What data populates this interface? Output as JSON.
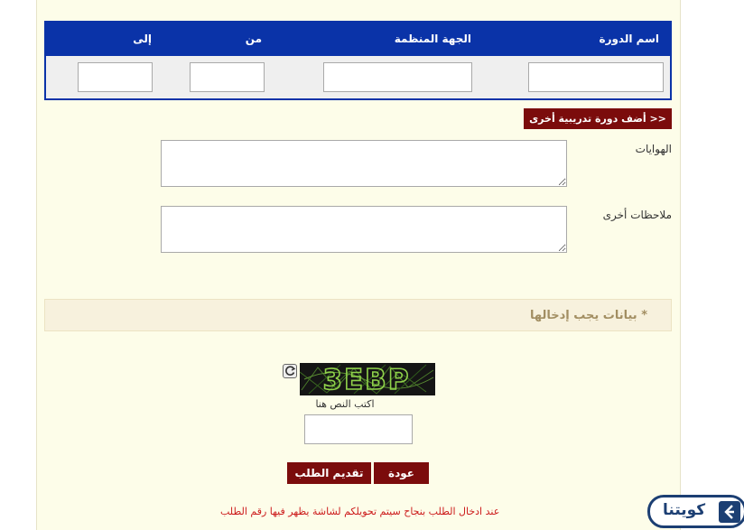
{
  "courses_table": {
    "headers": {
      "course_name": "اسم الدورة",
      "organizer": "الجهة المنظمة",
      "from": "من",
      "to": "إلى"
    },
    "row": {
      "course_name": "",
      "organizer": "",
      "from": "",
      "to": ""
    }
  },
  "add_course_button": "<< أضف دورة تدريبية أخرى",
  "hobbies": {
    "label": "الهوايات",
    "value": ""
  },
  "other_notes": {
    "label": "ملاحظات أخرى",
    "value": ""
  },
  "required_note": "* بيانات يجب إدخالها",
  "captcha": {
    "image_text": "3EBP",
    "hint": "اكتب النص هنا",
    "value": ""
  },
  "buttons": {
    "back": "عودة",
    "submit": "تقديم الطلب"
  },
  "notice": "عند ادخال الطلب بنجاح سيتم تحويلكم لشاشة يظهر فيها رقم الطلب",
  "logo": {
    "text": "كويتنا",
    "icon": "k-logo-icon"
  },
  "colors": {
    "table_header": "#0a33a8",
    "button_bg": "#7b0c0c",
    "notice_text": "#cc1a1a",
    "required_text": "#a28e62",
    "panel_bg": "#fdfde9"
  }
}
